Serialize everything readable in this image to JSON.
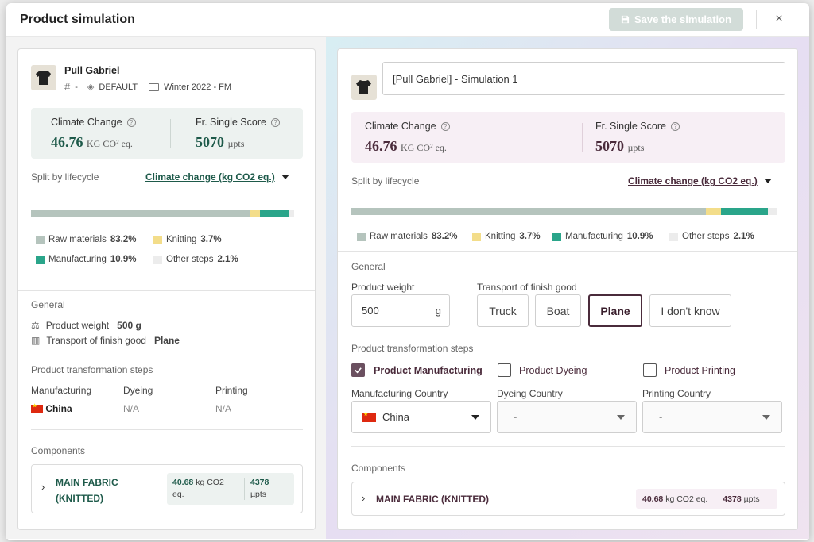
{
  "modal": {
    "title": "Product simulation",
    "save_label": "Save the simulation",
    "close_glyph": "×"
  },
  "left": {
    "product_name": "Pull Gabriel",
    "ref_value": "-",
    "tag": "DEFAULT",
    "collection": "Winter 2022 - FM",
    "kpi": {
      "climate_title": "Climate Change",
      "climate_value": "46.76",
      "climate_unit": "KG CO² eq.",
      "score_title": "Fr. Single Score",
      "score_value": "5070",
      "score_unit": "µpts"
    },
    "split_label": "Split by lifecycle",
    "split_dropdown": "Climate change (kg CO2 eq.)",
    "general_title": "General",
    "weight_label": "Product weight",
    "weight_value": "500 g",
    "transport_label": "Transport of finish good",
    "transport_value": "Plane",
    "steps_title": "Product transformation steps",
    "steps": {
      "manufacturing_label": "Manufacturing",
      "manufacturing_value": "China",
      "dyeing_label": "Dyeing",
      "dyeing_value": "N/A",
      "printing_label": "Printing",
      "printing_value": "N/A"
    },
    "components_title": "Components",
    "component": {
      "name_line1": "MAIN FABRIC",
      "name_line2": "(KNITTED)",
      "co2_value": "40.68",
      "co2_unit_line1": "kg CO2",
      "co2_unit_line2": "eq.",
      "pts_value": "4378",
      "pts_unit": "µpts"
    }
  },
  "right": {
    "simulation_name": "[Pull Gabriel] - Simulation 1",
    "kpi": {
      "climate_title": "Climate Change",
      "climate_value": "46.76",
      "climate_unit": "KG CO² eq.",
      "score_title": "Fr. Single Score",
      "score_value": "5070",
      "score_unit": "µpts"
    },
    "split_label": "Split by lifecycle",
    "split_dropdown": "Climate change (kg CO2 eq.)",
    "general_title": "General",
    "weight_label": "Product weight",
    "weight_value": "500",
    "weight_unit": "g",
    "transport_label": "Transport of finish good",
    "transport_options": [
      "Truck",
      "Boat",
      "Plane",
      "I don't know"
    ],
    "transport_selected": "Plane",
    "steps_title": "Product transformation steps",
    "step_checks": [
      {
        "label": "Product Manufacturing",
        "checked": true
      },
      {
        "label": "Product Dyeing",
        "checked": false
      },
      {
        "label": "Product Printing",
        "checked": false
      }
    ],
    "manufacturing_country_label": "Manufacturing Country",
    "manufacturing_country_value": "China",
    "dyeing_country_label": "Dyeing Country",
    "dyeing_country_value": "-",
    "printing_country_label": "Printing Country",
    "printing_country_value": "-",
    "components_title": "Components",
    "component": {
      "name": "MAIN FABRIC (KNITTED)",
      "co2_value": "40.68",
      "co2_unit": "kg CO2 eq.",
      "pts_value": "4378",
      "pts_unit": "µpts"
    }
  },
  "lifecycle": {
    "segments": [
      {
        "key": "raw",
        "label": "Raw materials",
        "pct": "83.2%",
        "value": 83.2,
        "color": "#b5c4bd"
      },
      {
        "key": "knit",
        "label": "Knitting",
        "pct": "3.7%",
        "value": 3.7,
        "color": "#f3dd8a"
      },
      {
        "key": "manu",
        "label": "Manufacturing",
        "pct": "10.9%",
        "value": 10.9,
        "color": "#2aa58a"
      },
      {
        "key": "other",
        "label": "Other steps",
        "pct": "2.1%",
        "value": 2.1,
        "color": "#ececec"
      }
    ]
  },
  "colors": {
    "accent_green": "#1e5a4a",
    "accent_plum": "#4a2b3b"
  }
}
